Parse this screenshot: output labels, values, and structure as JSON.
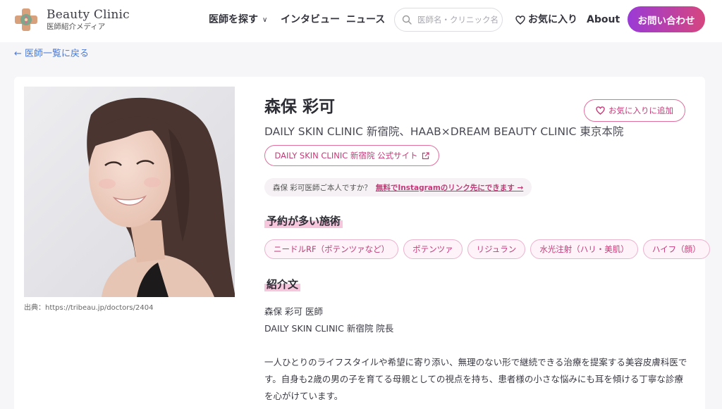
{
  "brand": {
    "title": "Beauty Clinic",
    "subtitle": "医師紹介メディア"
  },
  "nav": {
    "find_doctor": "医師を探す",
    "interview": "インタビュー",
    "news": "ニュース",
    "favorites": "お気に入り",
    "about": "About",
    "contact": "お問い合わせ"
  },
  "search": {
    "placeholder": "医師名・クリニック名で検索"
  },
  "back_link": "← 医師一覧に戻る",
  "doctor": {
    "name": "森保 彩可",
    "clinics": "DAILY SKIN CLINIC 新宿院、HAAB×DREAM BEAUTY CLINIC 東京本院",
    "favorite_button": "お気に入りに追加",
    "site_button": "DAILY SKIN CLINIC 新宿院 公式サイト",
    "source": "出典：https://tribeau.jp/doctors/2404"
  },
  "claim": {
    "question": "森保 彩可医師ご本人ですか？",
    "link": "無料でInstagramのリンク先にできます →"
  },
  "sections": {
    "treatments_title": "予約が多い施術",
    "intro_title": "紹介文"
  },
  "treatments": [
    "ニードルRF（ポテンツァなど）",
    "ポテンツァ",
    "リジュラン",
    "水光注射（ハリ・美肌）",
    "ハイフ（顔）"
  ],
  "intro": {
    "line1": "森保 彩可 医師",
    "line2": "DAILY SKIN CLINIC 新宿院 院長",
    "body": "一人ひとりのライフスタイルや希望に寄り添い、無理のない形で継続できる治療を提案する美容皮膚科医です。自身も2歳の男の子を育てる母親としての視点を持ち、患者様の小さな悩みにも耳を傾ける丁寧な診療を心がけています。"
  },
  "colors": {
    "accent_pink": "#c43a78",
    "contact_gradient_start": "#9a3ad6",
    "contact_gradient_end": "#d6467f",
    "link_blue": "#4a7ad9"
  }
}
